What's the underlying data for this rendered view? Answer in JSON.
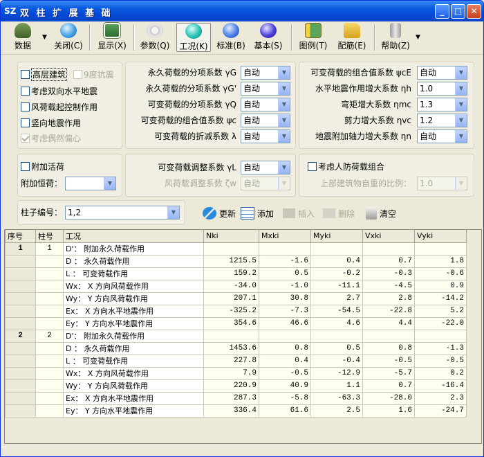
{
  "window": {
    "icon": "SZ",
    "title": "双 柱 扩 展 基 础"
  },
  "toolbar": {
    "items": [
      {
        "label": "数据",
        "icon": "database-icon"
      },
      {
        "label": "关闭(C)",
        "icon": "close-icon"
      },
      {
        "label": "显示(X)",
        "icon": "display-icon"
      },
      {
        "label": "参数(Q)",
        "icon": "params-icon"
      },
      {
        "label": "工况(K)",
        "icon": "teal-sphere-icon"
      },
      {
        "label": "标准(B)",
        "icon": "blue-sphere-icon"
      },
      {
        "label": "基本(S)",
        "icon": "indigo-sphere-icon"
      },
      {
        "label": "图例(T)",
        "icon": "legend-icon"
      },
      {
        "label": "配筋(E)",
        "icon": "rebar-icon"
      },
      {
        "label": "帮助(Z)",
        "icon": "help-icon"
      }
    ]
  },
  "panel1": {
    "tall_building": "高层建筑",
    "nine_degree": "9度抗震",
    "bidirectional": "考虑双向水平地震",
    "wind_control": "风荷载起控制作用",
    "vertical_quake": "竖向地震作用",
    "accidental": "考虑偶然偏心"
  },
  "panel2": {
    "rows": [
      {
        "label": "永久荷载的分项系数 γG",
        "value": "自动"
      },
      {
        "label": "永久荷载的分项系数 γG'",
        "value": "自动"
      },
      {
        "label": "可变荷载的分项系数 γQ",
        "value": "自动"
      },
      {
        "label": "可变荷载的组合值系数 ψc",
        "value": "自动"
      },
      {
        "label": "可变荷载的折减系数 λ",
        "value": "自动"
      }
    ]
  },
  "panel3": {
    "rows": [
      {
        "label": "可变荷载的组合值系数 ψcE",
        "value": "自动"
      },
      {
        "label": "水平地震作用增大系数 ηh",
        "value": "1.0"
      },
      {
        "label": "弯矩增大系数 ηmc",
        "value": "1.3"
      },
      {
        "label": "剪力增大系数 ηvc",
        "value": "1.2"
      },
      {
        "label": "地震附加轴力增大系数 ηn",
        "value": "自动"
      }
    ]
  },
  "panel4": {
    "additional_live": "附加活荷",
    "additional_dead": "附加恒荷：",
    "dead_value": ""
  },
  "panel5": {
    "live_adjust_label": "可变荷载调整系数 γL",
    "live_adjust_value": "自动",
    "wind_adjust_label": "风荷载调整系数 ζw",
    "wind_adjust_value": "自动"
  },
  "panel6": {
    "civil_defense": "考虑人防荷载组合",
    "self_weight_ratio_label": "上部建筑物自重的比例：",
    "self_weight_ratio_value": "1.0"
  },
  "column_select": {
    "label": "柱子编号：",
    "value": "1,2"
  },
  "actions": {
    "update": "更新",
    "add": "添加",
    "insert": "插入",
    "delete": "删除",
    "clear": "清空"
  },
  "table": {
    "headers": [
      "序号",
      "柱号",
      "工况",
      "Nki",
      "Mxki",
      "Myki",
      "Vxki",
      "Vyki"
    ],
    "rows": [
      [
        "1",
        "1",
        "D'： 附加永久荷载作用",
        "",
        "",
        "",
        "",
        ""
      ],
      [
        "",
        "",
        "D ： 永久荷载作用",
        "1215.5",
        "-1.6",
        "0.4",
        "0.7",
        "1.8"
      ],
      [
        "",
        "",
        "L ： 可变荷载作用",
        "159.2",
        "0.5",
        "-0.2",
        "-0.3",
        "-0.6"
      ],
      [
        "",
        "",
        "Wx： X 方向风荷载作用",
        "-34.0",
        "-1.0",
        "-11.1",
        "-4.5",
        "0.9"
      ],
      [
        "",
        "",
        "Wy： Y 方向风荷载作用",
        "207.1",
        "30.8",
        "2.7",
        "2.8",
        "-14.2"
      ],
      [
        "",
        "",
        "Ex： X 方向水平地震作用",
        "-325.2",
        "-7.3",
        "-54.5",
        "-22.8",
        "5.2"
      ],
      [
        "",
        "",
        "Ey： Y 方向水平地震作用",
        "354.6",
        "46.6",
        "4.6",
        "4.4",
        "-22.0"
      ],
      [
        "2",
        "2",
        "D'： 附加永久荷载作用",
        "",
        "",
        "",
        "",
        ""
      ],
      [
        "",
        "",
        "D ： 永久荷载作用",
        "1453.6",
        "0.8",
        "0.5",
        "0.8",
        "-1.3"
      ],
      [
        "",
        "",
        "L ： 可变荷载作用",
        "227.8",
        "0.4",
        "-0.4",
        "-0.5",
        "-0.5"
      ],
      [
        "",
        "",
        "Wx： X 方向风荷载作用",
        "7.9",
        "-0.5",
        "-12.9",
        "-5.7",
        "0.2"
      ],
      [
        "",
        "",
        "Wy： Y 方向风荷载作用",
        "220.9",
        "40.9",
        "1.1",
        "0.7",
        "-16.4"
      ],
      [
        "",
        "",
        "Ex： X 方向水平地震作用",
        "287.3",
        "-5.8",
        "-63.3",
        "-28.0",
        "2.3"
      ],
      [
        "",
        "",
        "Ey： Y 方向水平地震作用",
        "336.4",
        "61.6",
        "2.5",
        "1.6",
        "-24.7"
      ]
    ]
  }
}
